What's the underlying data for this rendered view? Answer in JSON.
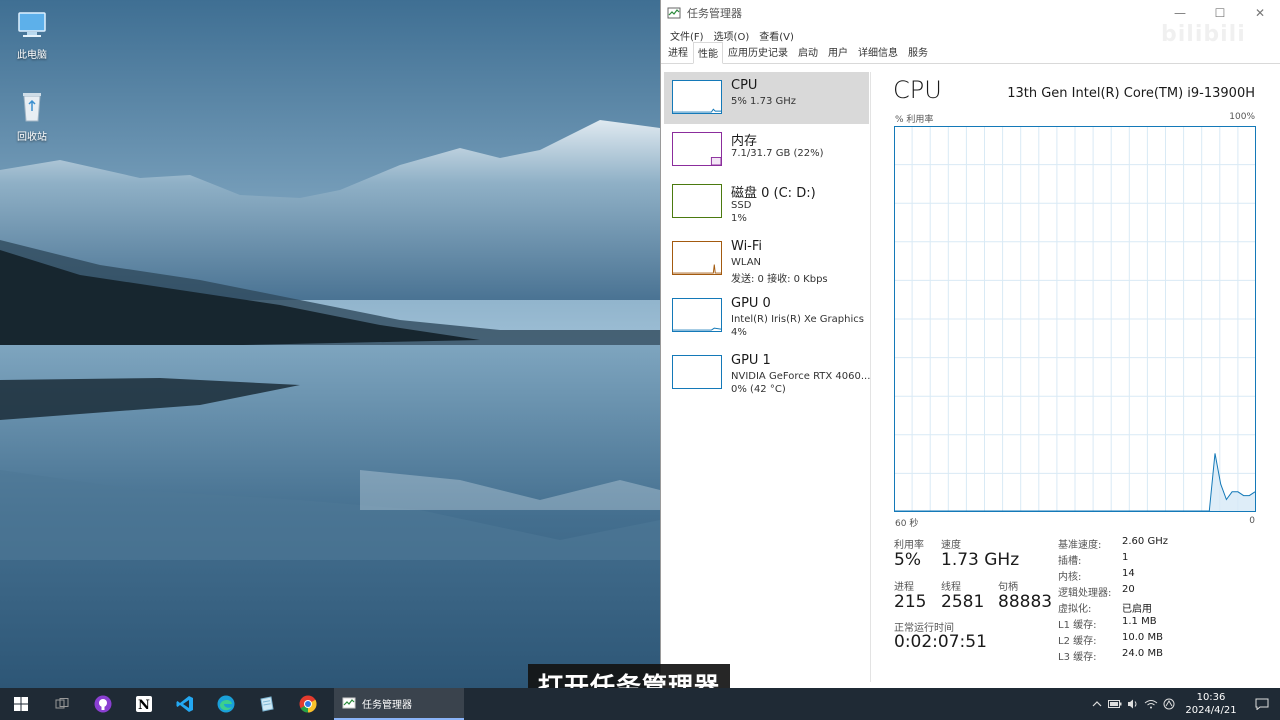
{
  "desktop": {
    "icons": [
      {
        "label": "此电脑",
        "icon": "computer-icon"
      },
      {
        "label": "回收站",
        "icon": "recycle-bin-icon"
      }
    ]
  },
  "window": {
    "title": "任务管理器",
    "controls": {
      "minimize": "—",
      "maximize": "☐",
      "close": "✕"
    }
  },
  "menu": [
    "文件(F)",
    "选项(O)",
    "查看(V)"
  ],
  "tabs": [
    "进程",
    "性能",
    "应用历史记录",
    "启动",
    "用户",
    "详细信息",
    "服务"
  ],
  "active_tab": "性能",
  "watermark": "bilibili",
  "resources": [
    {
      "name": "CPU",
      "line1": "5% 1.73 GHz",
      "line2": "",
      "color": "#1479b8",
      "selected": true
    },
    {
      "name": "内存",
      "line1": "7.1/31.7 GB (22%)",
      "line2": "",
      "color": "#8b2d9c",
      "selected": false
    },
    {
      "name": "磁盘 0 (C: D:)",
      "line1": "SSD",
      "line2": "1%",
      "color": "#4b7a0f",
      "selected": false
    },
    {
      "name": "Wi-Fi",
      "line1": "WLAN",
      "line2": "发送: 0 接收: 0 Kbps",
      "color": "#a35a0f",
      "selected": false
    },
    {
      "name": "GPU 0",
      "line1": "Intel(R) Iris(R) Xe Graphics",
      "line2": "4%",
      "color": "#1479b8",
      "selected": false
    },
    {
      "name": "GPU 1",
      "line1": "NVIDIA GeForce RTX 4060...",
      "line2": "0% (42 °C)",
      "color": "#1479b8",
      "selected": false
    }
  ],
  "detail": {
    "title": "CPU",
    "model": "13th Gen Intel(R) Core(TM) i9-13900H",
    "graph_label": "% 利用率",
    "graph_max": "100%",
    "graph_time": "60 秒",
    "graph_min": "0",
    "stats": {
      "utilization_label": "利用率",
      "utilization": "5%",
      "speed_label": "速度",
      "speed": "1.73 GHz",
      "processes_label": "进程",
      "processes": "215",
      "threads_label": "线程",
      "threads": "2581",
      "handles_label": "句柄",
      "handles": "88883",
      "uptime_label": "正常运行时间",
      "uptime": "0:02:07:51"
    },
    "specs": [
      {
        "label": "基准速度:",
        "value": "2.60 GHz"
      },
      {
        "label": "插槽:",
        "value": "1"
      },
      {
        "label": "内核:",
        "value": "14"
      },
      {
        "label": "逻辑处理器:",
        "value": "20"
      },
      {
        "label": "虚拟化:",
        "value": "已启用"
      },
      {
        "label": "L1 缓存:",
        "value": "1.1 MB"
      },
      {
        "label": "L2 缓存:",
        "value": "10.0 MB"
      },
      {
        "label": "L3 缓存:",
        "value": "24.0 MB"
      }
    ]
  },
  "chart_data": {
    "type": "area",
    "x_range": [
      60,
      0
    ],
    "ylim": [
      0,
      100
    ],
    "grid": true,
    "values": [
      0,
      0,
      0,
      0,
      0,
      0,
      0,
      0,
      0,
      0,
      0,
      0,
      0,
      0,
      0,
      0,
      0,
      0,
      0,
      0,
      0,
      0,
      0,
      0,
      0,
      0,
      0,
      0,
      0,
      0,
      0,
      0,
      0,
      0,
      0,
      0,
      0,
      0,
      0,
      0,
      0,
      0,
      0,
      0,
      0,
      0,
      0,
      0,
      0,
      0,
      0,
      0,
      0,
      0,
      0,
      0,
      15,
      7,
      3,
      5,
      5,
      4,
      4,
      5
    ]
  },
  "subtitle": "打开任务管理器",
  "taskbar": {
    "apps": [
      "start-icon",
      "task-view-icon",
      "github-icon",
      "notion-icon",
      "vscode-icon",
      "edge-icon",
      "notepad-icon",
      "chrome-icon"
    ],
    "active_app": "任务管理器",
    "time": "10:36",
    "date": "2024/4/21"
  }
}
